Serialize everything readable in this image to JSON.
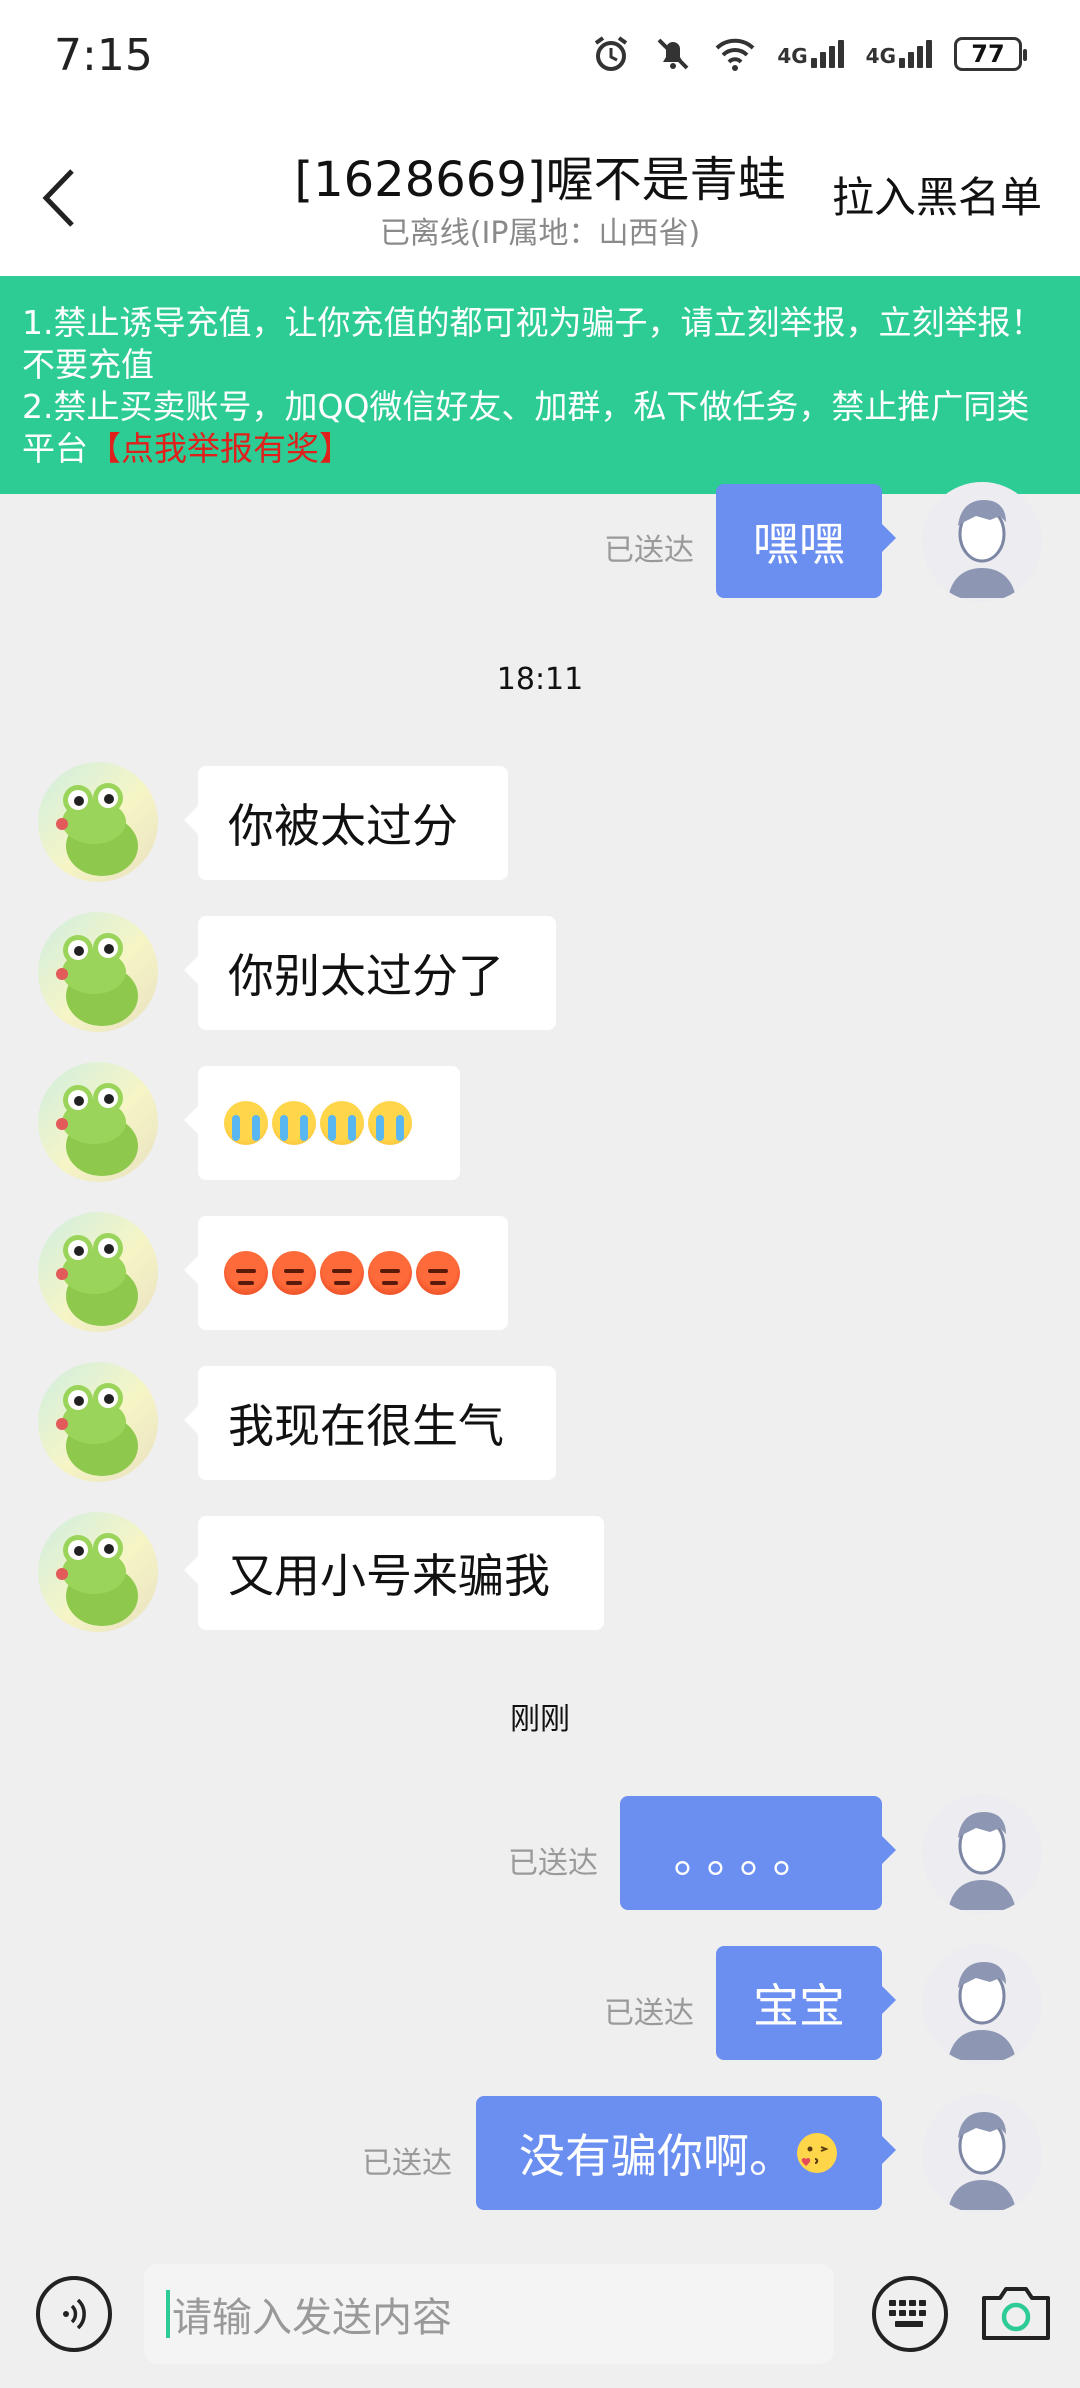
{
  "status_bar": {
    "time": "7:15",
    "network1": "4G",
    "network2": "4G",
    "battery": "77"
  },
  "header": {
    "title": "[1628669]喔不是青蛙",
    "subtitle": "已离线(IP属地：山西省)",
    "blacklist_label": "拉入黑名单"
  },
  "notice": {
    "line1": "1.禁止诱导充值，让你充值的都可视为骗子，请立刻举报，立刻举报！不要充值",
    "line2": "2.禁止买卖账号，加QQ微信好友、加群，私下做任务，禁止推广同类平台",
    "report_link": "【点我举报有奖】"
  },
  "messages": {
    "m0": {
      "text": "嘿嘿",
      "status": "已送达"
    },
    "time1": "18:11",
    "m1": {
      "text": "你被太过分"
    },
    "m2": {
      "text": "你别太过分了"
    },
    "m3": {
      "emoji": "crying-face x4"
    },
    "m4": {
      "emoji": "angry-face x5"
    },
    "m5": {
      "text": "我现在很生气"
    },
    "m6": {
      "text": "又用小号来骗我"
    },
    "time2": "刚刚",
    "m7": {
      "text": "。。。。",
      "status": "已送达"
    },
    "m8": {
      "text": "宝宝",
      "status": "已送达"
    },
    "m9": {
      "text": "没有骗你啊。",
      "status": "已送达"
    }
  },
  "input": {
    "placeholder": "请输入发送内容"
  },
  "colors": {
    "accent_green": "#2ecc95",
    "bubble_blue": "#6a8ff1",
    "report_red": "#e0201a"
  }
}
